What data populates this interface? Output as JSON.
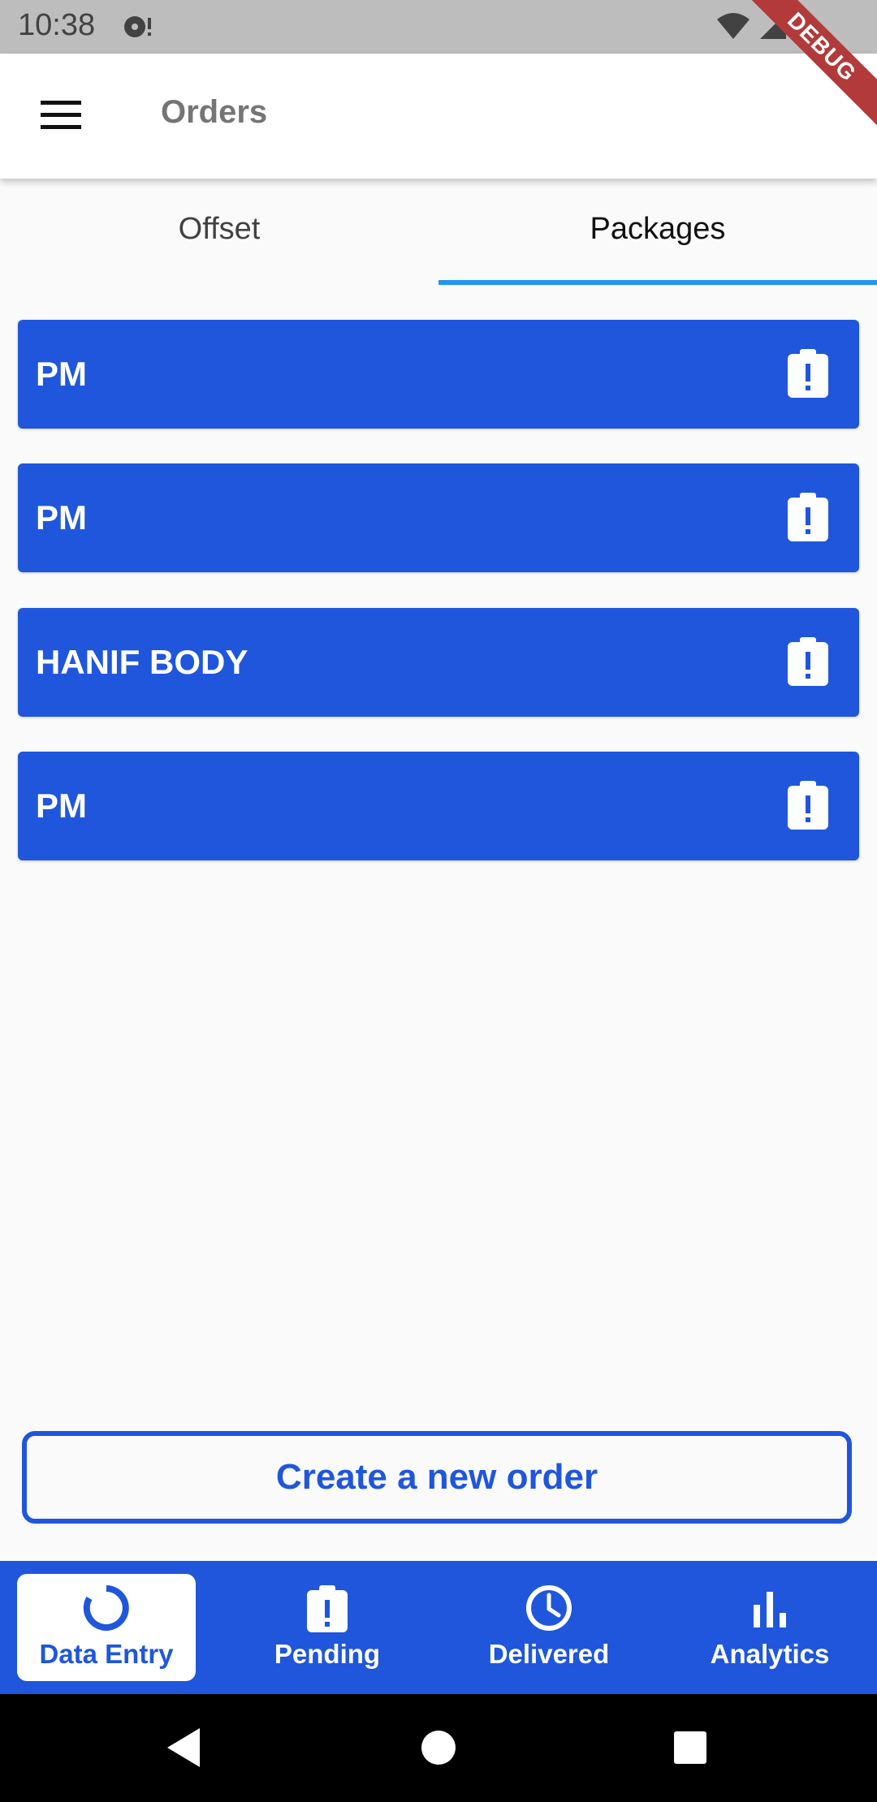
{
  "status_bar": {
    "time": "10:38"
  },
  "debug_banner": "DEBUG",
  "app_bar": {
    "title": "Orders"
  },
  "tabs": [
    {
      "label": "Offset",
      "selected": false
    },
    {
      "label": "Packages",
      "selected": true
    }
  ],
  "orders": [
    {
      "name": "PM",
      "icon": "pending-clipboard-icon"
    },
    {
      "name": "PM",
      "icon": "pending-clipboard-icon"
    },
    {
      "name": "HANIF BODY",
      "icon": "pending-clipboard-icon"
    },
    {
      "name": "PM",
      "icon": "pending-clipboard-icon"
    }
  ],
  "create_button": {
    "label": "Create a new order"
  },
  "bottom_nav": {
    "items": [
      {
        "label": "Data Entry",
        "icon": "data-entry-icon",
        "active": true
      },
      {
        "label": "Pending",
        "icon": "pending-icon",
        "active": false
      },
      {
        "label": "Delivered",
        "icon": "clock-icon",
        "active": false
      },
      {
        "label": "Analytics",
        "icon": "bar-chart-icon",
        "active": false
      }
    ]
  },
  "colors": {
    "primary": "#1f56dc",
    "tab_indicator": "#2196f3",
    "background": "#fafafa",
    "status_bar": "#bdbdbd",
    "debug_ribbon": "#b23a3a"
  }
}
